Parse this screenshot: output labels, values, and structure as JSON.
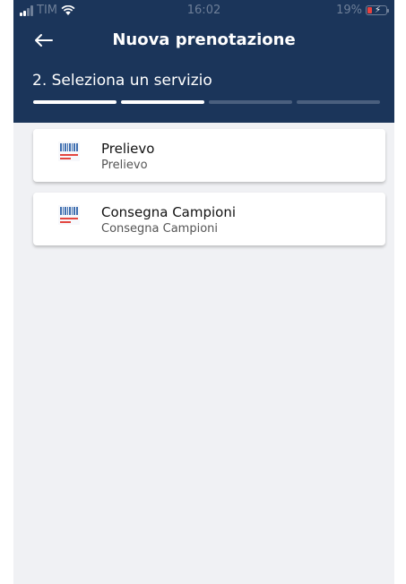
{
  "status_bar": {
    "carrier": "TIM",
    "time": "16:02",
    "battery": "19%"
  },
  "header": {
    "title": "Nuova prenotazione",
    "step_label": "2. Seleziona un servizio",
    "back_icon": "arrow-left-icon",
    "progress": {
      "total_steps": 4,
      "completed_steps": 2
    }
  },
  "services": [
    {
      "name": "Prelievo",
      "description": "Prelievo",
      "icon": "barcode-icon"
    },
    {
      "name": "Consegna Campioni",
      "description": "Consegna Campioni",
      "icon": "barcode-icon"
    }
  ],
  "colors": {
    "header_bg": "#1b355a",
    "page_bg": "#f0f1f4",
    "card_bg": "#ffffff",
    "icon_blue": "#3f6fb0",
    "icon_red": "#e3463f"
  }
}
